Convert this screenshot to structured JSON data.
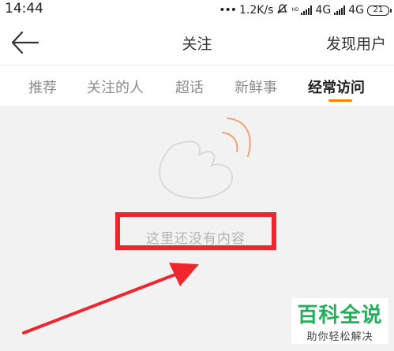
{
  "status_bar": {
    "time": "14:44",
    "dots": "•••",
    "speed": "1.2K/s",
    "hd_label": "HD",
    "network_1": "4G",
    "network_2": "4G",
    "battery_level": "21",
    "icons": [
      "mute-icon",
      "signal-icon",
      "signal-icon",
      "battery-icon"
    ]
  },
  "nav": {
    "title": "关注",
    "action_label": "发现用户",
    "back_icon": "back-arrow-icon"
  },
  "tabs": {
    "items": [
      {
        "label": "推荐",
        "active": false
      },
      {
        "label": "关注的人",
        "active": false
      },
      {
        "label": "超话",
        "active": false
      },
      {
        "label": "新鲜事",
        "active": false
      },
      {
        "label": "经常访问",
        "active": true
      }
    ],
    "accent_color": "#ff8200"
  },
  "empty_state": {
    "message": "这里还没有内容",
    "icon": "weibo-logo-outline-icon",
    "highlight_color": "#f0262e"
  },
  "watermark": {
    "title": "百科全说",
    "subtitle": "助你轻松解决",
    "color": "#1fb25a"
  }
}
